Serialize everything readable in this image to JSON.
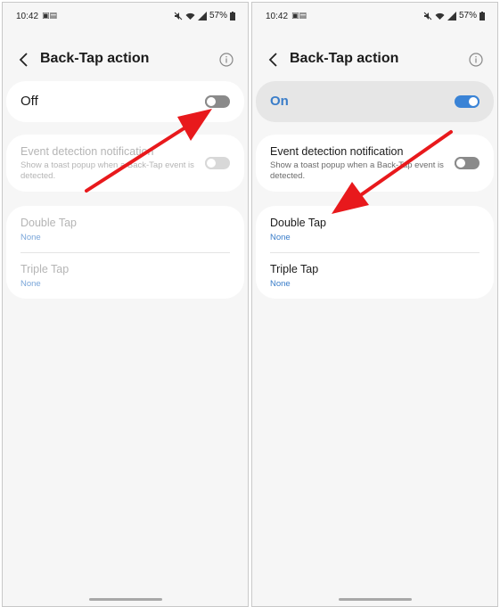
{
  "colors": {
    "accent": "#3a7dc9",
    "toggle_on": "#3a83d6",
    "arrow": "#e8191c"
  },
  "status_bar": {
    "time": "10:42",
    "battery": "57%"
  },
  "header": {
    "title": "Back-Tap action"
  },
  "left_screen": {
    "master_toggle": {
      "label": "Off",
      "state": "off"
    },
    "event_notification": {
      "title": "Event detection notification",
      "description": "Show a toast popup when a Back-Tap event is detected.",
      "state": "off",
      "enabled": false
    },
    "tap_actions": [
      {
        "label": "Double Tap",
        "value": "None"
      },
      {
        "label": "Triple Tap",
        "value": "None"
      }
    ]
  },
  "right_screen": {
    "master_toggle": {
      "label": "On",
      "state": "on"
    },
    "event_notification": {
      "title": "Event detection notification",
      "description": "Show a toast popup when a Back-Tap event is detected.",
      "state": "off",
      "enabled": true
    },
    "tap_actions": [
      {
        "label": "Double Tap",
        "value": "None"
      },
      {
        "label": "Triple Tap",
        "value": "None"
      }
    ]
  }
}
